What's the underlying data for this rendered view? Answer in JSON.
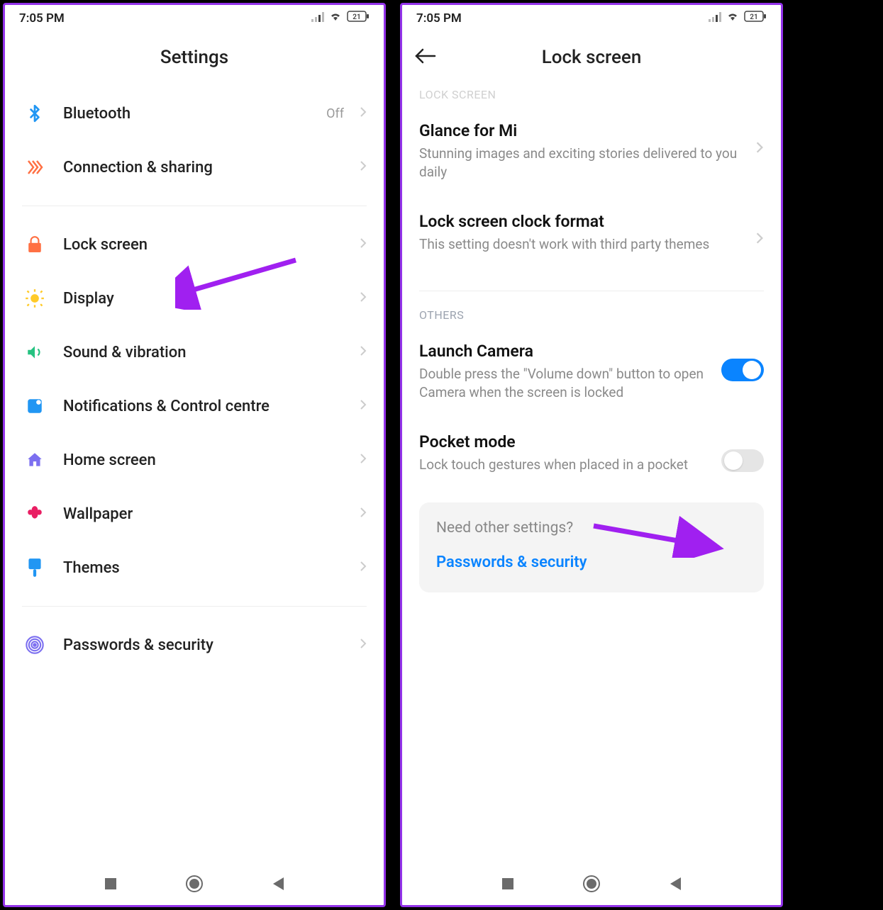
{
  "status": {
    "time": "7:05 PM",
    "battery": "21"
  },
  "left": {
    "title": "Settings",
    "items": {
      "bluetooth": {
        "label": "Bluetooth",
        "value": "Off"
      },
      "connection": {
        "label": "Connection & sharing"
      },
      "lockscreen": {
        "label": "Lock screen"
      },
      "display": {
        "label": "Display"
      },
      "sound": {
        "label": "Sound & vibration"
      },
      "notifications": {
        "label": "Notifications & Control centre"
      },
      "home": {
        "label": "Home screen"
      },
      "wallpaper": {
        "label": "Wallpaper"
      },
      "themes": {
        "label": "Themes"
      },
      "passwords": {
        "label": "Passwords & security"
      }
    }
  },
  "right": {
    "title": "Lock screen",
    "section_cut": "LOCK SCREEN",
    "glance": {
      "title": "Glance for Mi",
      "desc": "Stunning images and exciting stories delivered to you daily"
    },
    "clock": {
      "title": "Lock screen clock format",
      "desc": "This setting doesn't work with third party themes"
    },
    "section_others": "OTHERS",
    "camera": {
      "title": "Launch Camera",
      "desc": "Double press the \"Volume down\" button to open Camera when the screen is locked"
    },
    "pocket": {
      "title": "Pocket mode",
      "desc": "Lock touch gestures when placed in a pocket"
    },
    "suggest": {
      "q": "Need other settings?",
      "link": "Passwords & security"
    }
  },
  "colors": {
    "accent": "#0a84ff",
    "annotation": "#9333ea"
  }
}
